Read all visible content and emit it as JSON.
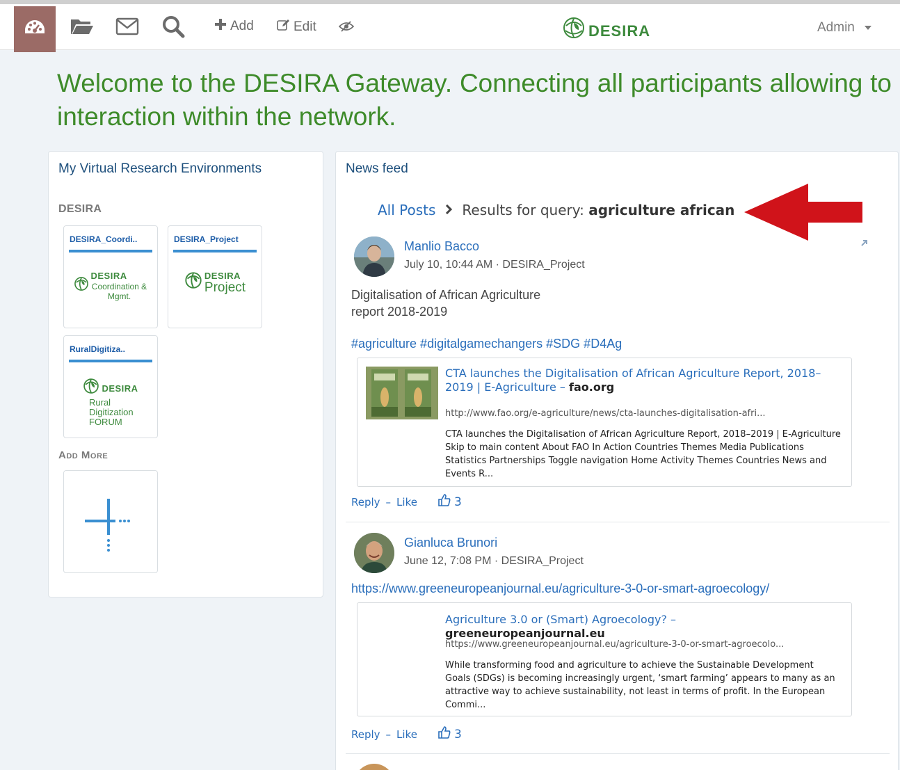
{
  "toolbar": {
    "add_label": "Add",
    "edit_label": "Edit",
    "icons": [
      "dashboard-icon",
      "folder-icon",
      "mail-icon",
      "search-icon",
      "plus-icon",
      "edit-icon",
      "hide-icon"
    ]
  },
  "brand": {
    "logo_text": "DESIRA",
    "color": "#3d8a3d"
  },
  "user": {
    "name": "Admin"
  },
  "welcome": {
    "text": "Welcome to the DESIRA Gateway. Connecting all participants allowing to interaction within the network."
  },
  "vre_panel": {
    "title": "My Virtual Research Environments",
    "group": "DESIRA",
    "cards": [
      {
        "name": "DESIRA_Coordi..",
        "logo_word": "DESIRA",
        "logo_sub": "Coordination & Mgmt."
      },
      {
        "name": "DESIRA_Project",
        "logo_word": "DESIRA",
        "logo_sub": "Project"
      },
      {
        "name": "RuralDigitiza..",
        "logo_word": "DESIRA",
        "logo_sub": "Rural Digitization FORUM"
      }
    ],
    "add_more": "Add More"
  },
  "news_panel": {
    "title": "News feed",
    "breadcrumb": {
      "root": "All Posts",
      "label": "Results for query:",
      "query": "agriculture african"
    },
    "posts": [
      {
        "author": "Manlio Bacco",
        "meta": "July 10, 10:44 AM · DESIRA_Project",
        "body_line1": "Digitalisation of African Agriculture",
        "body_line2": "report 2018-2019",
        "tags": "#agriculture #digitalgamechangers #SDG #D4Ag",
        "preview": {
          "title": "CTA launches the Digitalisation of African Agriculture Report, 2018–2019 | E-Agriculture",
          "site": "fao.org",
          "url": "http://www.fao.org/e-agriculture/news/cta-launches-digitalisation-afri...",
          "description": "CTA launches the Digitalisation of African Agriculture Report, 2018–2019 | E-Agriculture Skip to main content About FAO In Action Countries Themes Media Publications Statistics Partnerships Toggle navigation Home Activity Themes Countries News and Events R..."
        },
        "reply": "Reply",
        "like": "Like",
        "likes": "3"
      },
      {
        "author": "Gianluca Brunori",
        "meta": "June 12, 7:08 PM · DESIRA_Project",
        "link": "https://www.greeneuropeanjournal.eu/agriculture-3-0-or-smart-agroecology/",
        "preview": {
          "title": "Agriculture 3.0 or (Smart) Agroecology?",
          "site": "greeneuropeanjournal.eu",
          "url": "https://www.greeneuropeanjournal.eu/agriculture-3-0-or-smart-agroecolo...",
          "description": "While transforming food and agriculture to achieve the Sustainable Development Goals (SDGs) is becoming increasingly urgent, ‘smart farming’ appears to many as an attractive way to achieve sustainability, not least in terms of profit. In the European Commi..."
        },
        "reply": "Reply",
        "like": "Like",
        "likes": "3"
      }
    ]
  },
  "annotation": {
    "arrow_color": "#d0131a"
  }
}
